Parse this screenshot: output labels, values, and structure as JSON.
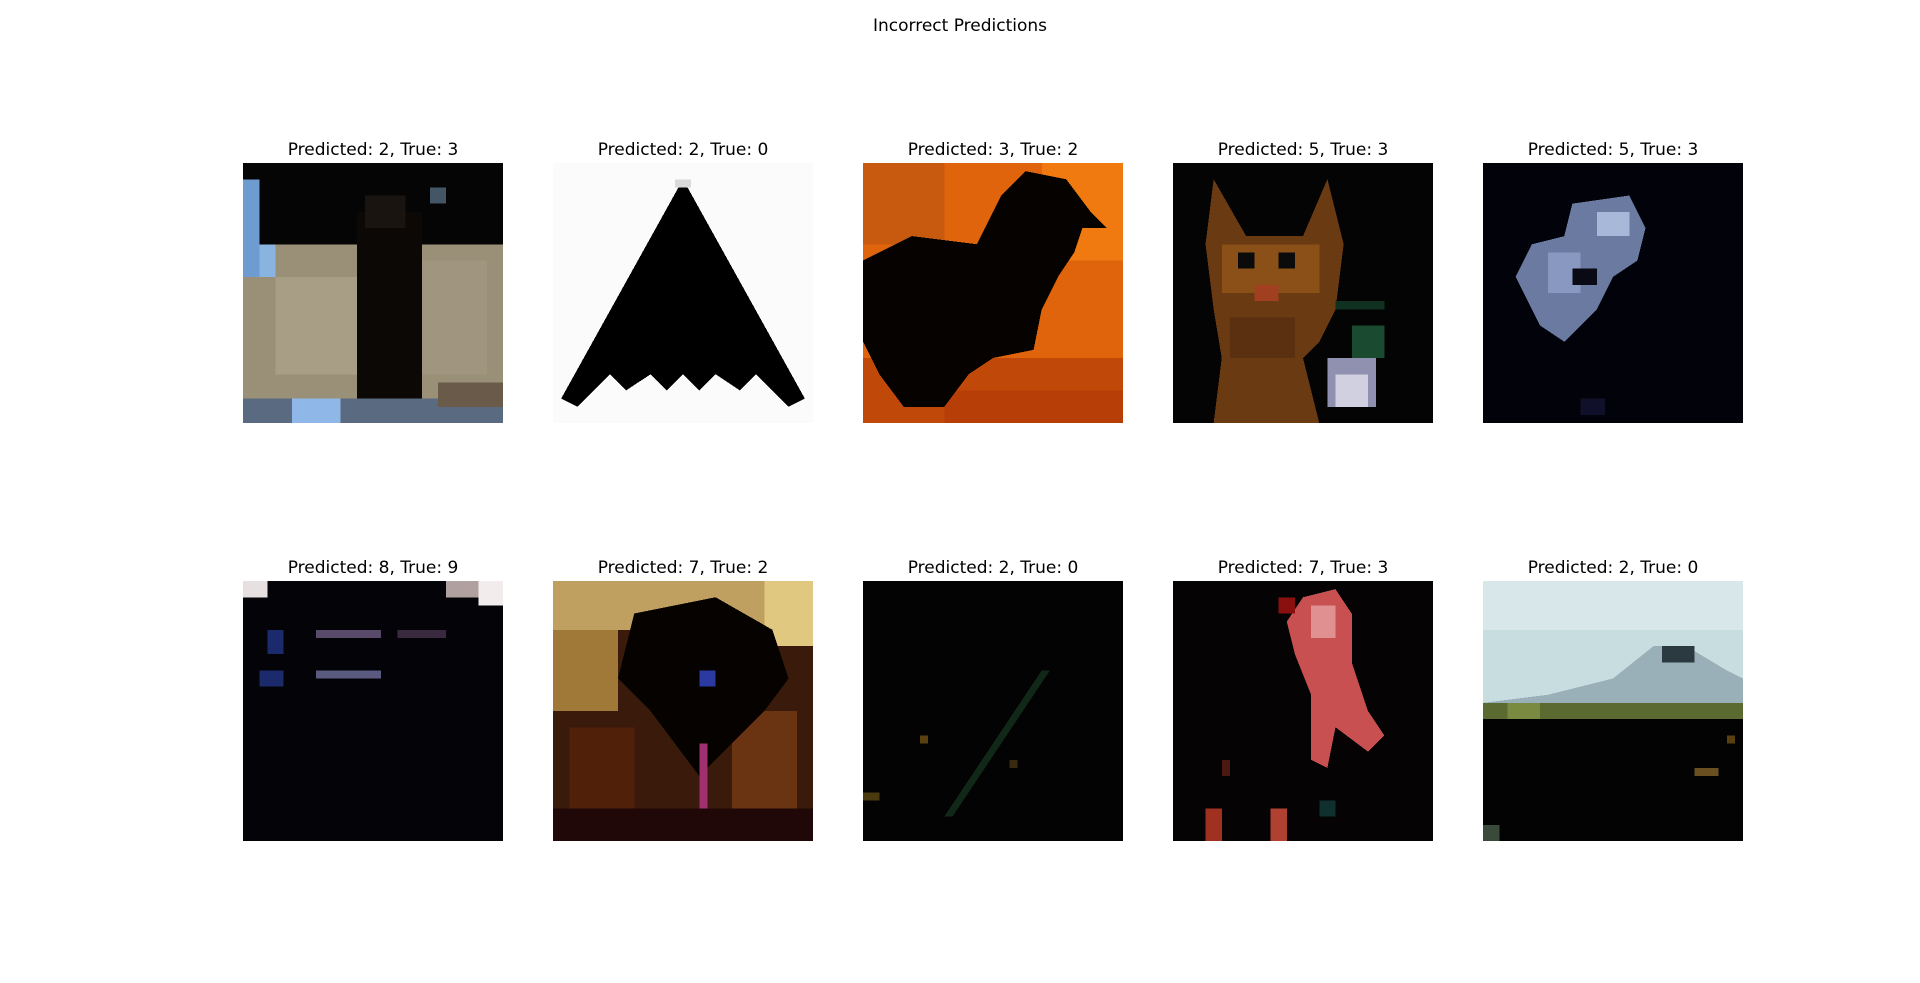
{
  "figure": {
    "title": "Incorrect Predictions",
    "panels": [
      {
        "title": "Predicted: 2, True: 3"
      },
      {
        "title": "Predicted: 2, True: 0"
      },
      {
        "title": "Predicted: 3, True: 2"
      },
      {
        "title": "Predicted: 5, True: 3"
      },
      {
        "title": "Predicted: 5, True: 3"
      },
      {
        "title": "Predicted: 8, True: 9"
      },
      {
        "title": "Predicted: 7, True: 2"
      },
      {
        "title": "Predicted: 2, True: 0"
      },
      {
        "title": "Predicted: 7, True: 3"
      },
      {
        "title": "Predicted: 2, True: 0"
      }
    ]
  }
}
